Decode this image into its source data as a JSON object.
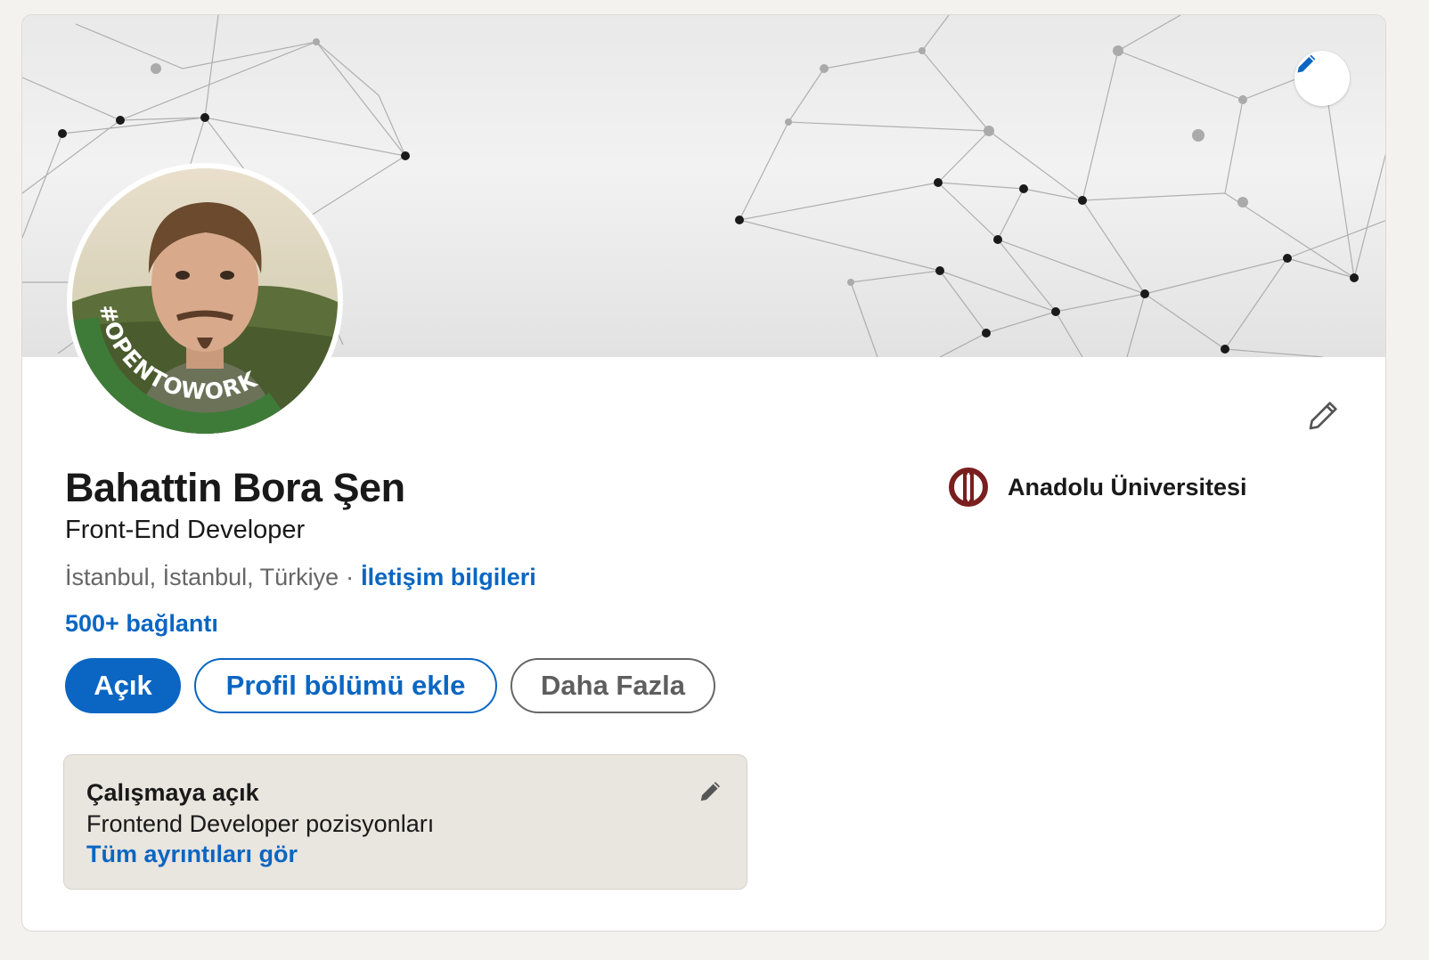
{
  "profile": {
    "name": "Bahattin Bora Şen",
    "headline": "Front-End Developer",
    "location": "İstanbul, İstanbul, Türkiye",
    "separator": "·",
    "contact_link": "İletişim bilgileri",
    "connections": "500+ bağlantı",
    "avatar_badge": "#OPENTOWORK"
  },
  "education": {
    "school_name": "Anadolu Üniversitesi"
  },
  "actions": {
    "open_label": "Açık",
    "add_section_label": "Profil bölümü ekle",
    "more_label": "Daha Fazla"
  },
  "open_to_work": {
    "title": "Çalışmaya açık",
    "subtitle": "Frontend Developer pozisyonları",
    "details_link": "Tüm ayrıntıları gör"
  },
  "icons": {
    "banner_edit": "pencil-icon",
    "profile_edit": "pencil-icon",
    "otw_edit": "pencil-icon",
    "school_logo": "anadolu-logo-icon"
  },
  "colors": {
    "accent": "#0a66c2",
    "otw_green": "#3e7b38",
    "school_logo": "#7a1f1f",
    "card_bg": "#ffffff",
    "page_bg": "#f3f2ef",
    "otw_card_bg": "#e9e5df"
  }
}
